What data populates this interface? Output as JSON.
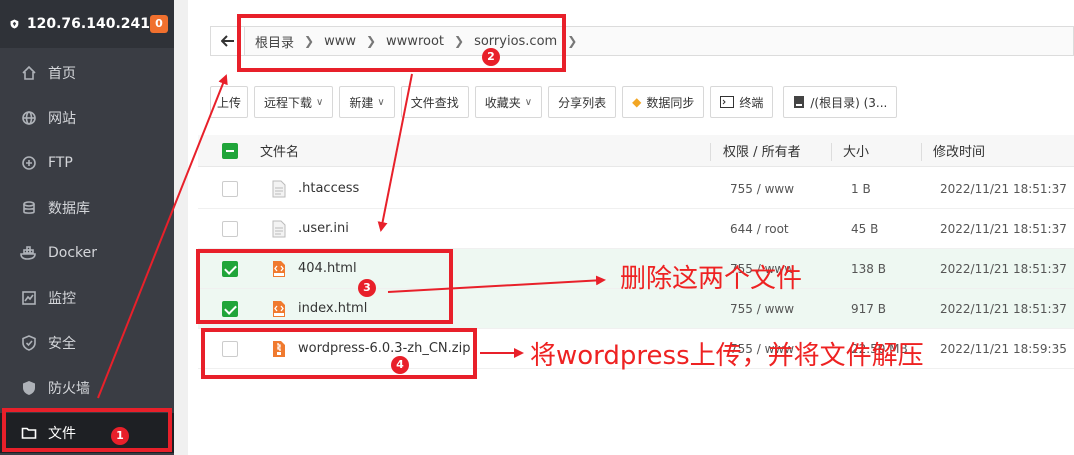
{
  "sidebar": {
    "server_ip": "120.76.140.241",
    "badge_count": "0",
    "items": [
      {
        "label": "首页",
        "icon": "home-icon"
      },
      {
        "label": "网站",
        "icon": "globe-icon"
      },
      {
        "label": "FTP",
        "icon": "ftp-icon"
      },
      {
        "label": "数据库",
        "icon": "database-icon"
      },
      {
        "label": "Docker",
        "icon": "docker-icon"
      },
      {
        "label": "监控",
        "icon": "monitor-icon"
      },
      {
        "label": "安全",
        "icon": "shield-icon"
      },
      {
        "label": "防火墙",
        "icon": "firewall-icon"
      },
      {
        "label": "文件",
        "icon": "folder-icon",
        "active": true
      }
    ]
  },
  "breadcrumb": [
    "根目录",
    "www",
    "wwwroot",
    "sorryios.com"
  ],
  "toolbar": {
    "upload": "上传",
    "remote_download": "远程下载",
    "new": "新建",
    "file_search": "文件查找",
    "favorites": "收藏夹",
    "share_list": "分享列表",
    "data_sync": "数据同步",
    "terminal": "终端",
    "disk": "/(根目录) (3..."
  },
  "table": {
    "headers": {
      "name": "文件名",
      "perm": "权限 / 所有者",
      "size": "大小",
      "mtime": "修改时间"
    },
    "rows": [
      {
        "name": ".htaccess",
        "perm": "755 / www",
        "size": "1 B",
        "mtime": "2022/11/21 18:51:37",
        "checked": false
      },
      {
        "name": ".user.ini",
        "perm": "644 / root",
        "size": "45 B",
        "mtime": "2022/11/21 18:51:37",
        "checked": false
      },
      {
        "name": "404.html",
        "perm": "755 / www",
        "size": "138 B",
        "mtime": "2022/11/21 18:51:37",
        "checked": true
      },
      {
        "name": "index.html",
        "perm": "755 / www",
        "size": "917 B",
        "mtime": "2022/11/21 18:51:37",
        "checked": true
      },
      {
        "name": "wordpress-6.0.3-zh_CN.zip",
        "perm": "755 / www",
        "size": "22.50 MB",
        "mtime": "2022/11/21 18:59:35",
        "checked": false
      }
    ]
  },
  "annotations": {
    "step1": "1",
    "step2": "2",
    "step3": "3",
    "step4": "4",
    "note_delete": "删除这两个文件",
    "note_upload": "将wordpress上传，并将文件解压"
  },
  "colors": {
    "accent": "#20a53a",
    "annotation": "#e8202a",
    "badge": "#f0702e"
  }
}
